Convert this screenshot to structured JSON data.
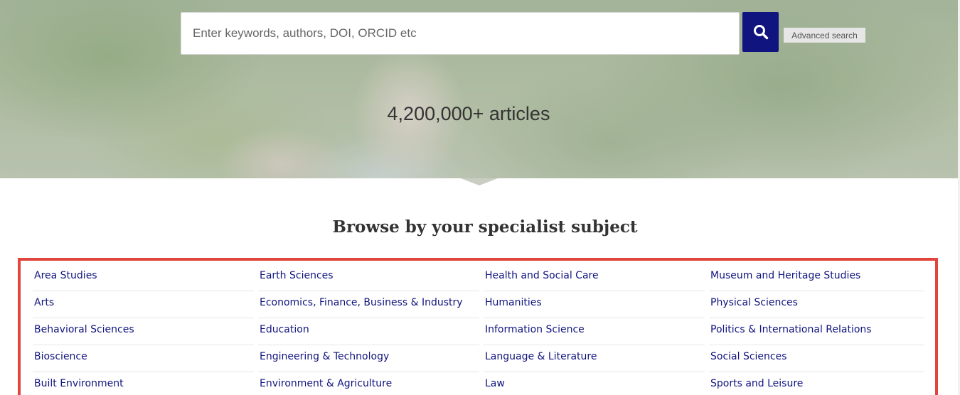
{
  "search": {
    "placeholder": "Enter keywords, authors, DOI, ORCID etc",
    "advanced_label": "Advanced search",
    "button_icon": "search-icon"
  },
  "hero": {
    "article_count": "4,200,000+ articles"
  },
  "browse": {
    "heading": "Browse by your specialist subject",
    "subjects": [
      "Area Studies",
      "Earth Sciences",
      "Health and Social Care",
      "Museum and Heritage Studies",
      "Arts",
      "Economics, Finance, Business & Industry",
      "Humanities",
      "Physical Sciences",
      "Behavioral Sciences",
      "Education",
      "Information Science",
      "Politics & International Relations",
      "Bioscience",
      "Engineering & Technology",
      "Language & Literature",
      "Social Sciences",
      "Built Environment",
      "Environment & Agriculture",
      "Law",
      "Sports and Leisure"
    ]
  },
  "colors": {
    "brand_navy": "#10147e",
    "highlight_red": "#e0463d"
  }
}
